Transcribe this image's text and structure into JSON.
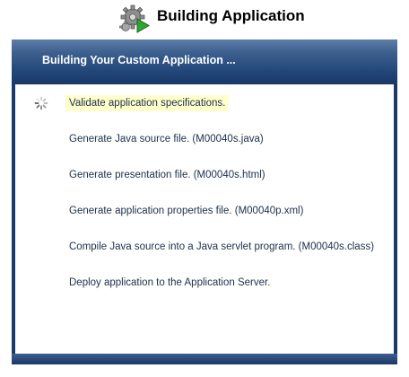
{
  "app": {
    "title": "Building Application",
    "icon": "gears-play-icon"
  },
  "panel": {
    "header_title": "Building Your Custom Application ..."
  },
  "steps": [
    {
      "label": "Validate application specifications.",
      "status": "in-progress",
      "icon": "spinner-icon"
    },
    {
      "label": "Generate Java source file. (M00040s.java)",
      "status": "pending"
    },
    {
      "label": "Generate presentation file. (M00040s.html)",
      "status": "pending"
    },
    {
      "label": "Generate application properties file. (M00040p.xml)",
      "status": "pending"
    },
    {
      "label": "Compile Java source into a Java servlet program. (M00040s.class)",
      "status": "pending"
    },
    {
      "label": "Deploy application to the Application Server.",
      "status": "pending"
    }
  ],
  "colors": {
    "panel_dark": "#1b3a6b",
    "header_light": "#5d7ea8",
    "active_highlight": "#ffffcc",
    "step_text": "#1e2e4a"
  }
}
